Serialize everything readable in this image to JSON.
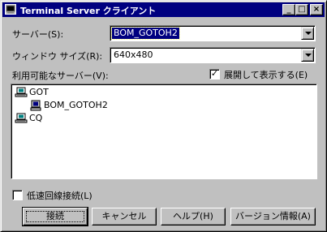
{
  "window": {
    "title": "Terminal Server クライアント",
    "controls": {
      "minimize": "_",
      "maximize": "□",
      "close": "×"
    }
  },
  "server": {
    "label": "サーバー(S):",
    "value": "BOM_GOTOH2"
  },
  "window_size": {
    "label": "ウィンドウ サイズ(R):",
    "value": "640x480"
  },
  "available_servers": {
    "label": "利用可能なサーバー(V):",
    "expand_checkbox": {
      "label": "展開して表示する(E)",
      "checked": true,
      "mark": "✓"
    },
    "tree": [
      {
        "name": "GOT",
        "icon": "domain-icon",
        "level": 0
      },
      {
        "name": "BOM_GOTOH2",
        "icon": "computer-icon",
        "level": 1
      },
      {
        "name": "CQ",
        "icon": "domain-icon",
        "level": 0
      }
    ]
  },
  "low_speed": {
    "label": "低速回線接続(L)",
    "checked": false
  },
  "buttons": {
    "connect": "接続",
    "cancel": "キャンセル",
    "help": "ヘルプ(H)",
    "version": "バージョン情報(A)"
  },
  "colors": {
    "titlebar": "#000080",
    "face": "#c0c0c0",
    "selection": "#000080"
  }
}
